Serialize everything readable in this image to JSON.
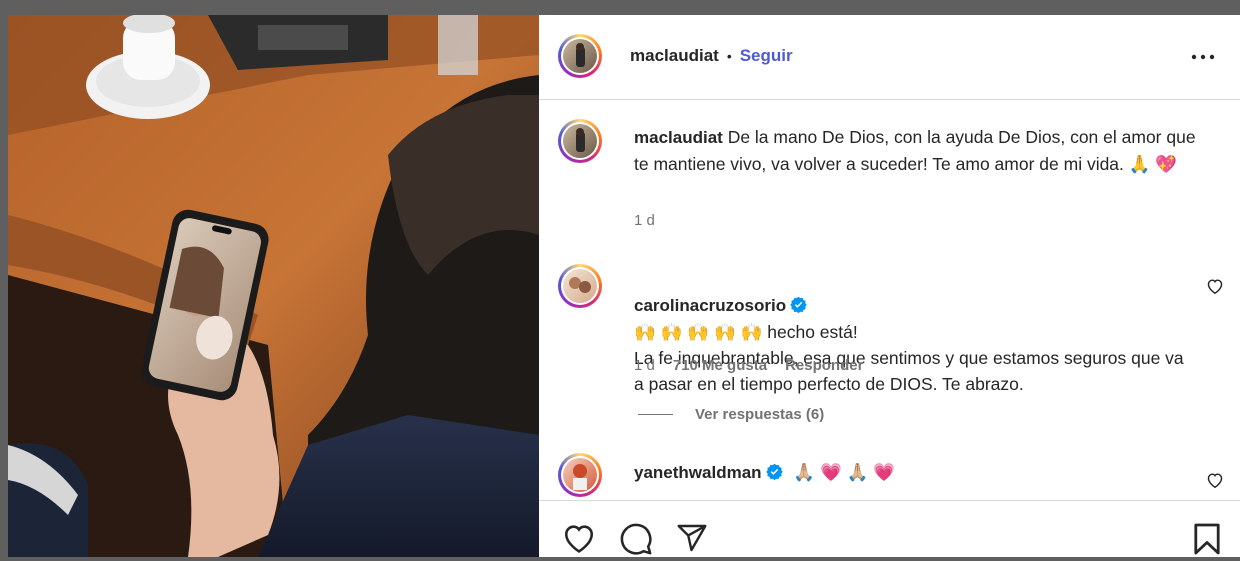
{
  "post": {
    "username": "maclaudiat",
    "separator": "•",
    "follow_label": "Seguir",
    "more_icon": "more-horizontal-icon"
  },
  "caption": {
    "username": "maclaudiat",
    "text": "De la mano De Dios, con la ayuda De Dios, con el amor que te mantiene vivo, va volver a suceder! Te amo amor de mi vida. 🙏 💖",
    "time": "1 d"
  },
  "comments": [
    {
      "username": "carolinacruzosorio",
      "verified": true,
      "text": "🙌 🙌 🙌 🙌 🙌  hecho está!\nLa fe inquebrantable, esa que sentimos y que estamos seguros que va a pasar en el tiempo perfecto de DIOS. Te abrazo.",
      "time": "1 d",
      "likes": "710 Me gusta",
      "reply_label": "Responder",
      "view_replies": "Ver respuestas (6)"
    },
    {
      "username": "yanethwaldman",
      "verified": true,
      "text": "🙏🏼 💗 🙏🏼 💗"
    }
  ],
  "actions": {
    "like_icon": "heart-icon",
    "comment_icon": "comment-icon",
    "share_icon": "share-icon",
    "save_icon": "bookmark-icon"
  },
  "colors": {
    "follow": "#4f5bd5",
    "verified": "#0095f6",
    "text": "#262626",
    "muted": "#737373"
  }
}
